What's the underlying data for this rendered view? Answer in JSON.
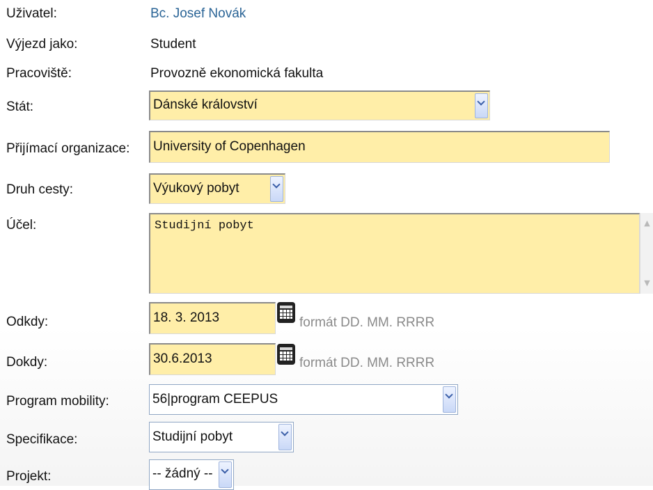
{
  "user": {
    "label": "Uživatel:",
    "value": "Bc. Josef Novák"
  },
  "trip_as": {
    "label": "Výjezd jako:",
    "value": "Student"
  },
  "workplace": {
    "label": "Pracoviště:",
    "value": "Provozně ekonomická fakulta"
  },
  "country": {
    "label": "Stát:",
    "value": "Dánské království"
  },
  "host_org": {
    "label": "Přijímací organizace:",
    "value": "University of Copenhagen"
  },
  "trip_type": {
    "label": "Druh cesty:",
    "value": "Výukový pobyt"
  },
  "purpose": {
    "label": "Účel:",
    "value": "Studijní pobyt"
  },
  "date_from": {
    "label": "Odkdy:",
    "value": "18. 3. 2013",
    "hint": "formát DD. MM. RRRR"
  },
  "date_to": {
    "label": "Dokdy:",
    "value": "30.6.2013",
    "hint": "formát DD. MM. RRRR"
  },
  "mobility_program": {
    "label": "Program mobility:",
    "value": "56|program CEEPUS"
  },
  "specification": {
    "label": "Specifikace:",
    "value": "Studijní pobyt"
  },
  "project": {
    "label": "Projekt:",
    "value": "-- žádný --"
  },
  "icons": {
    "select_arrow": "chevron-down-icon",
    "calendar": "calendar-icon",
    "scroll_up": "scroll-up-arrow-icon",
    "scroll_down": "scroll-down-arrow-icon"
  },
  "colors": {
    "required_field_bg": "#ffeea8",
    "link": "#2a6496",
    "hint": "#8a8a8a"
  }
}
